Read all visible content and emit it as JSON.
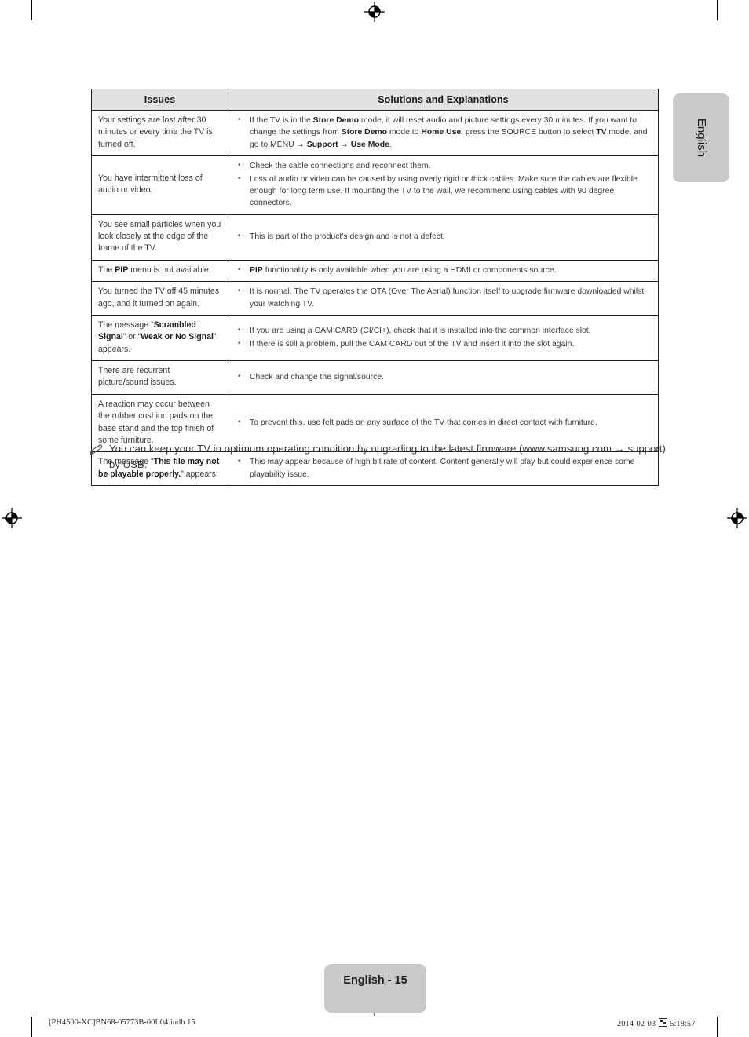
{
  "page": {
    "side_tab_label": "English",
    "page_badge": "English - 15",
    "slug_left": "[PH4500-XC]BN68-05773B-00L04.indb   15",
    "slug_right_date": "2014-02-03",
    "slug_right_time": "5:18:57",
    "accent_gray": "#c9c9c9",
    "header_fill": "#e2e2e2",
    "rule_color": "#1d1d1d"
  },
  "table": {
    "headers": {
      "issues": "Issues",
      "solutions": "Solutions and Explanations"
    },
    "rows": [
      {
        "issue": "Your settings are lost after 30 minutes or every time the TV is turned off.",
        "issue_html": "Your settings are lost after 30 minutes or every time the TV is turned off.",
        "solutions_html": [
          "If the TV is in the <b>Store Demo</b> mode, it will reset audio and picture settings every 30 minutes. If you want to change the settings from <b>Store Demo</b> mode to <b>Home Use</b>, press the SOURCE button to select <b>TV</b> mode, and go to MENU &#8594; <b>Support</b> &#8594; <b>Use Mode</b>."
        ]
      },
      {
        "issue": "You have intermittent loss of audio or video.",
        "issue_html": "You have intermittent loss of audio or video.",
        "solutions_html": [
          "Check the cable connections and reconnect them.",
          "Loss of audio or video can be caused by using overly rigid or thick cables. Make sure the cables are flexible enough for long term use. If mounting the TV to the wall, we recommend using cables with 90 degree connectors."
        ]
      },
      {
        "issue": "You see small particles when you look closely at the edge of the frame of the TV.",
        "issue_html": "You see small particles when you look closely at the edge of the frame of the TV.",
        "solutions_html": [
          "This is part of the product&#8217;s design and is not a defect."
        ]
      },
      {
        "issue": "The PIP menu is not available.",
        "issue_html": "The <b>PIP</b> menu is not available.",
        "solutions_html": [
          "<b>PIP</b> functionality is only available when you are using a HDMI or components source."
        ]
      },
      {
        "issue": "You turned the TV off 45 minutes ago, and it turned on again.",
        "issue_html": "You turned the TV off 45 minutes ago, and it turned on again.",
        "solutions_html": [
          "It is normal. The TV operates the OTA (Over The Aerial) function itself to upgrade firmware downloaded whilst your watching TV."
        ]
      },
      {
        "issue": "The message “Scrambled Signal” or “Weak or No Signal” appears.",
        "issue_html": "The message &#8220;<b>Scrambled Signal</b>&#8221; or &#8220;<b>Weak or No Signal</b>&#8221; appears.",
        "solutions_html": [
          "If you are using a CAM CARD (CI/CI+), check that it is installed into the common interface slot.",
          "If there is still a problem, pull the CAM CARD out of the TV and insert it into the slot again."
        ]
      },
      {
        "issue": "There are recurrent picture/sound issues.",
        "issue_html": "There are recurrent picture/sound issues.",
        "solutions_html": [
          "Check and change the signal/source."
        ]
      },
      {
        "issue": "A reaction may occur between the rubber cushion pads on the base stand and the top finish of some furniture.",
        "issue_html": "A reaction may occur between the rubber cushion pads on the base stand and the top finish of some furniture.",
        "solutions_html": [
          "To prevent this, use felt pads on any surface of the TV that comes in direct contact with furniture."
        ]
      },
      {
        "issue": "The message “This file may not be playable properly.” appears.",
        "issue_html": "The message &#8220;<b>This file may not be playable properly.</b>&#8221; appears.",
        "solutions_html": [
          "This may appear because of high bit rate of content. Content generally will play but could experience some playability issue."
        ]
      }
    ]
  },
  "note": {
    "icon": "note-pencil-icon",
    "text_html": "You can keep your TV in optimum operating condition by upgrading to the latest firmware (www.samsung.com &#8594; support) by USB."
  }
}
